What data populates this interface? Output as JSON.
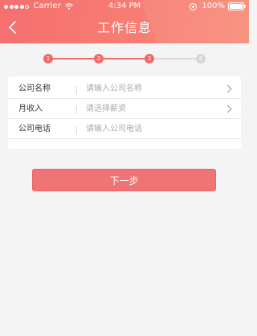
{
  "status_bar": {
    "carrier": "Carrier",
    "time": "4:34 PM",
    "battery": "100%"
  },
  "header": {
    "title": "工作信息",
    "back_icon": "chevron-left-icon"
  },
  "progress": {
    "current_step": 3,
    "steps": [
      "1",
      "2",
      "3",
      "4"
    ]
  },
  "form": {
    "rows": [
      {
        "label": "公司名称",
        "placeholder": "请输入公司名称",
        "has_arrow": true
      },
      {
        "label": "月收入",
        "placeholder": "请选择薪资",
        "has_arrow": true
      },
      {
        "label": "公司电话",
        "placeholder": "请输入公司电话",
        "has_arrow": false
      }
    ]
  },
  "actions": {
    "next_label": "下一步"
  },
  "colors": {
    "accent": "#ef6a6a",
    "inactive": "#d6d6d6"
  }
}
